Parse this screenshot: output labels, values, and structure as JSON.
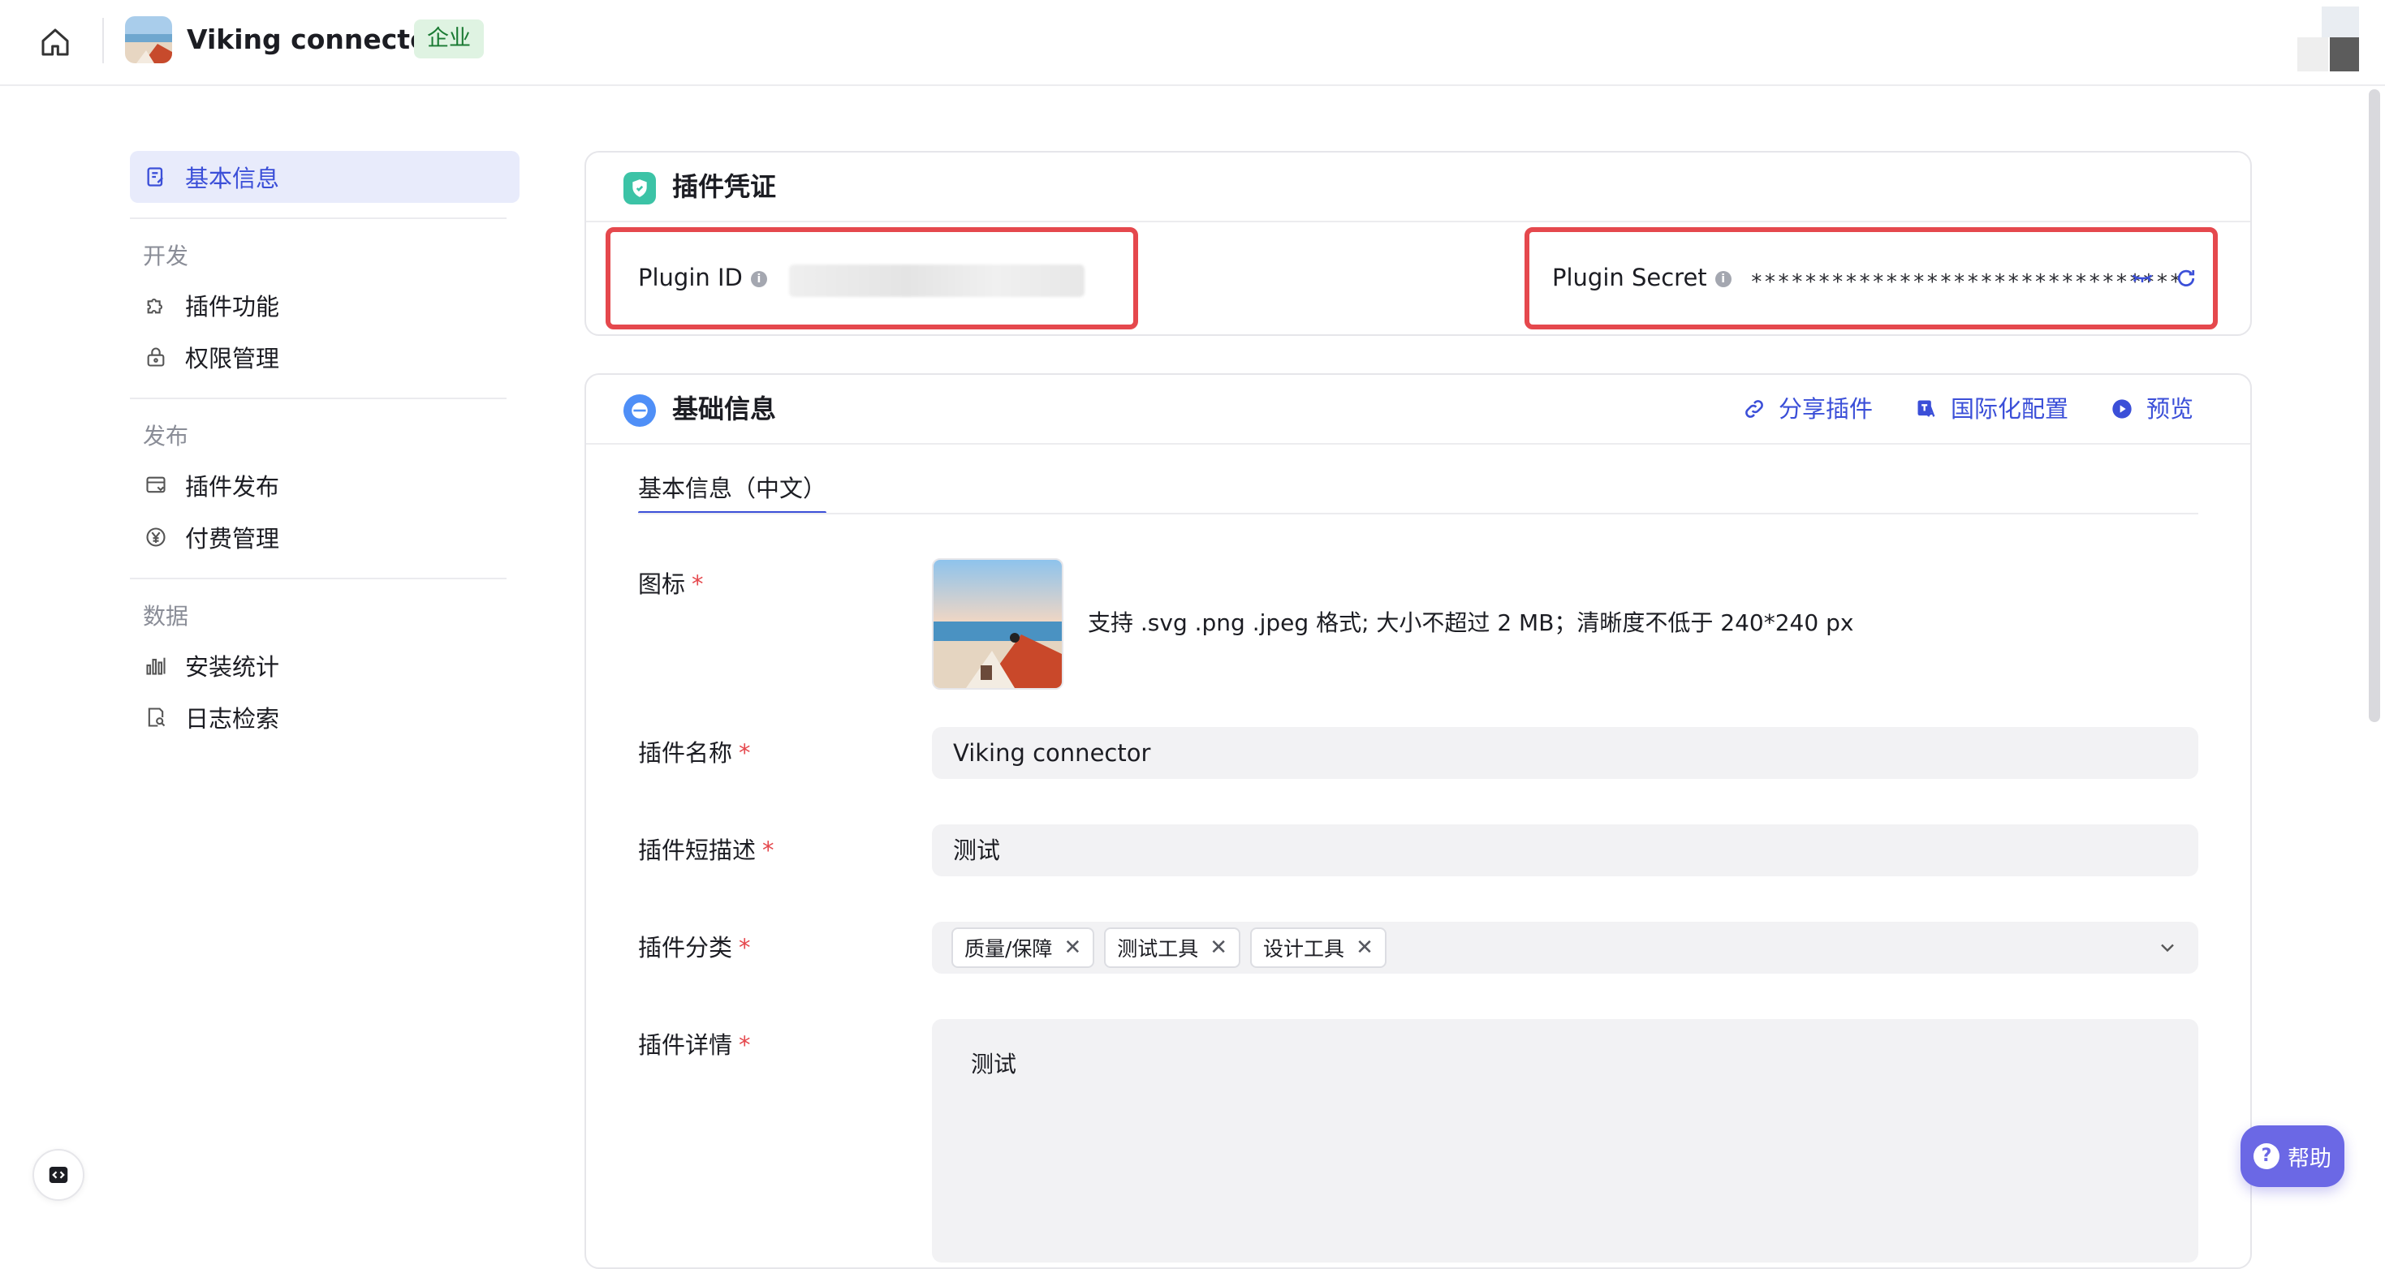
{
  "topbar": {
    "title": "Viking connector",
    "badge": "企业"
  },
  "sidebar": {
    "items": [
      {
        "label": "基本信息",
        "icon": "edit-doc-icon",
        "active": true
      }
    ],
    "groups": [
      {
        "title": "开发",
        "items": [
          {
            "label": "插件功能",
            "icon": "puzzle-icon"
          },
          {
            "label": "权限管理",
            "icon": "lock-icon"
          }
        ]
      },
      {
        "title": "发布",
        "items": [
          {
            "label": "插件发布",
            "icon": "publish-icon"
          },
          {
            "label": "付费管理",
            "icon": "yen-icon"
          }
        ]
      },
      {
        "title": "数据",
        "items": [
          {
            "label": "安装统计",
            "icon": "bar-chart-icon"
          },
          {
            "label": "日志检索",
            "icon": "log-search-icon"
          }
        ]
      }
    ]
  },
  "credentials": {
    "title": "插件凭证",
    "plugin_id_label": "Plugin ID",
    "plugin_secret_label": "Plugin Secret",
    "plugin_secret_value": "********************************"
  },
  "basic_info": {
    "title": "基础信息",
    "actions": {
      "share": "分享插件",
      "i18n": "国际化配置",
      "preview": "预览"
    },
    "tab": "基本信息（中文）",
    "fields": {
      "icon_label": "图标",
      "icon_hint": "支持 .svg .png .jpeg 格式; 大小不超过 2 MB；清晰度不低于 240*240 px",
      "name_label": "插件名称",
      "name_value": "Viking connector",
      "short_desc_label": "插件短描述",
      "short_desc_value": "测试",
      "category_label": "插件分类",
      "categories": [
        "质量/保障",
        "测试工具",
        "设计工具"
      ],
      "detail_label": "插件详情",
      "detail_value": "测试"
    }
  },
  "help": {
    "label": "帮助"
  },
  "colors": {
    "accent": "#3b4fd8",
    "highlight_border": "#e5484d",
    "badge_bg": "#dff3e2",
    "help_bg": "#6b68e5"
  }
}
